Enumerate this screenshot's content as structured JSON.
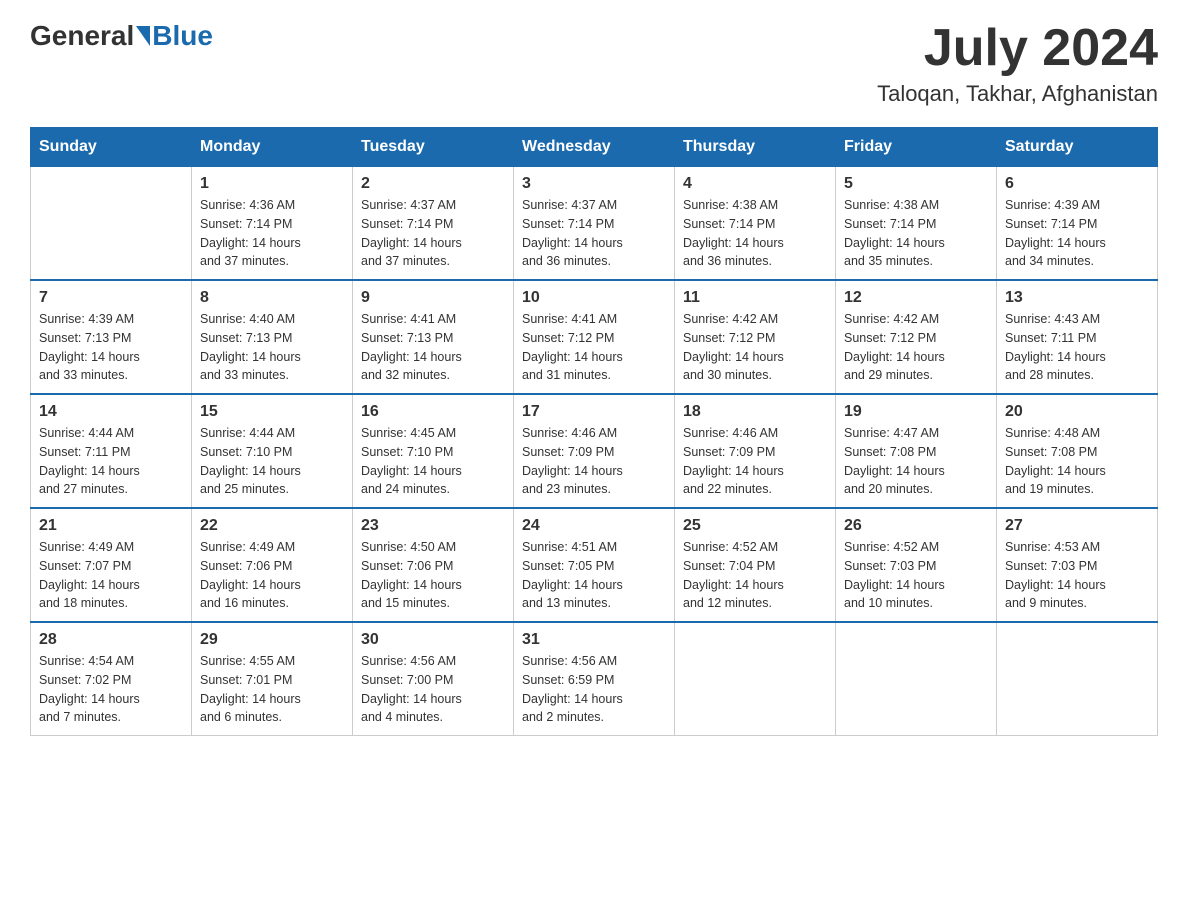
{
  "header": {
    "logo_general": "General",
    "logo_blue": "Blue",
    "month_year": "July 2024",
    "location": "Taloqan, Takhar, Afghanistan"
  },
  "days_of_week": [
    "Sunday",
    "Monday",
    "Tuesday",
    "Wednesday",
    "Thursday",
    "Friday",
    "Saturday"
  ],
  "weeks": [
    [
      {
        "num": "",
        "info": ""
      },
      {
        "num": "1",
        "info": "Sunrise: 4:36 AM\nSunset: 7:14 PM\nDaylight: 14 hours\nand 37 minutes."
      },
      {
        "num": "2",
        "info": "Sunrise: 4:37 AM\nSunset: 7:14 PM\nDaylight: 14 hours\nand 37 minutes."
      },
      {
        "num": "3",
        "info": "Sunrise: 4:37 AM\nSunset: 7:14 PM\nDaylight: 14 hours\nand 36 minutes."
      },
      {
        "num": "4",
        "info": "Sunrise: 4:38 AM\nSunset: 7:14 PM\nDaylight: 14 hours\nand 36 minutes."
      },
      {
        "num": "5",
        "info": "Sunrise: 4:38 AM\nSunset: 7:14 PM\nDaylight: 14 hours\nand 35 minutes."
      },
      {
        "num": "6",
        "info": "Sunrise: 4:39 AM\nSunset: 7:14 PM\nDaylight: 14 hours\nand 34 minutes."
      }
    ],
    [
      {
        "num": "7",
        "info": "Sunrise: 4:39 AM\nSunset: 7:13 PM\nDaylight: 14 hours\nand 33 minutes."
      },
      {
        "num": "8",
        "info": "Sunrise: 4:40 AM\nSunset: 7:13 PM\nDaylight: 14 hours\nand 33 minutes."
      },
      {
        "num": "9",
        "info": "Sunrise: 4:41 AM\nSunset: 7:13 PM\nDaylight: 14 hours\nand 32 minutes."
      },
      {
        "num": "10",
        "info": "Sunrise: 4:41 AM\nSunset: 7:12 PM\nDaylight: 14 hours\nand 31 minutes."
      },
      {
        "num": "11",
        "info": "Sunrise: 4:42 AM\nSunset: 7:12 PM\nDaylight: 14 hours\nand 30 minutes."
      },
      {
        "num": "12",
        "info": "Sunrise: 4:42 AM\nSunset: 7:12 PM\nDaylight: 14 hours\nand 29 minutes."
      },
      {
        "num": "13",
        "info": "Sunrise: 4:43 AM\nSunset: 7:11 PM\nDaylight: 14 hours\nand 28 minutes."
      }
    ],
    [
      {
        "num": "14",
        "info": "Sunrise: 4:44 AM\nSunset: 7:11 PM\nDaylight: 14 hours\nand 27 minutes."
      },
      {
        "num": "15",
        "info": "Sunrise: 4:44 AM\nSunset: 7:10 PM\nDaylight: 14 hours\nand 25 minutes."
      },
      {
        "num": "16",
        "info": "Sunrise: 4:45 AM\nSunset: 7:10 PM\nDaylight: 14 hours\nand 24 minutes."
      },
      {
        "num": "17",
        "info": "Sunrise: 4:46 AM\nSunset: 7:09 PM\nDaylight: 14 hours\nand 23 minutes."
      },
      {
        "num": "18",
        "info": "Sunrise: 4:46 AM\nSunset: 7:09 PM\nDaylight: 14 hours\nand 22 minutes."
      },
      {
        "num": "19",
        "info": "Sunrise: 4:47 AM\nSunset: 7:08 PM\nDaylight: 14 hours\nand 20 minutes."
      },
      {
        "num": "20",
        "info": "Sunrise: 4:48 AM\nSunset: 7:08 PM\nDaylight: 14 hours\nand 19 minutes."
      }
    ],
    [
      {
        "num": "21",
        "info": "Sunrise: 4:49 AM\nSunset: 7:07 PM\nDaylight: 14 hours\nand 18 minutes."
      },
      {
        "num": "22",
        "info": "Sunrise: 4:49 AM\nSunset: 7:06 PM\nDaylight: 14 hours\nand 16 minutes."
      },
      {
        "num": "23",
        "info": "Sunrise: 4:50 AM\nSunset: 7:06 PM\nDaylight: 14 hours\nand 15 minutes."
      },
      {
        "num": "24",
        "info": "Sunrise: 4:51 AM\nSunset: 7:05 PM\nDaylight: 14 hours\nand 13 minutes."
      },
      {
        "num": "25",
        "info": "Sunrise: 4:52 AM\nSunset: 7:04 PM\nDaylight: 14 hours\nand 12 minutes."
      },
      {
        "num": "26",
        "info": "Sunrise: 4:52 AM\nSunset: 7:03 PM\nDaylight: 14 hours\nand 10 minutes."
      },
      {
        "num": "27",
        "info": "Sunrise: 4:53 AM\nSunset: 7:03 PM\nDaylight: 14 hours\nand 9 minutes."
      }
    ],
    [
      {
        "num": "28",
        "info": "Sunrise: 4:54 AM\nSunset: 7:02 PM\nDaylight: 14 hours\nand 7 minutes."
      },
      {
        "num": "29",
        "info": "Sunrise: 4:55 AM\nSunset: 7:01 PM\nDaylight: 14 hours\nand 6 minutes."
      },
      {
        "num": "30",
        "info": "Sunrise: 4:56 AM\nSunset: 7:00 PM\nDaylight: 14 hours\nand 4 minutes."
      },
      {
        "num": "31",
        "info": "Sunrise: 4:56 AM\nSunset: 6:59 PM\nDaylight: 14 hours\nand 2 minutes."
      },
      {
        "num": "",
        "info": ""
      },
      {
        "num": "",
        "info": ""
      },
      {
        "num": "",
        "info": ""
      }
    ]
  ]
}
